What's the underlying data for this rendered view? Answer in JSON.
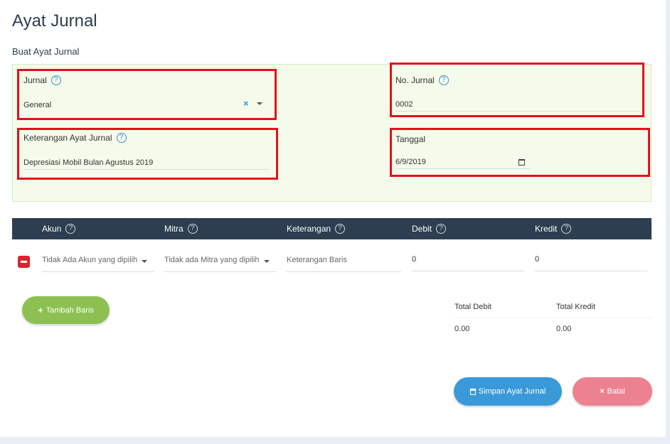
{
  "page": {
    "title": "Ayat Jurnal",
    "section_title": "Buat Ayat Jurnal"
  },
  "form": {
    "jurnal_label": "Jurnal",
    "jurnal_value": "General",
    "no_jurnal_label": "No. Jurnal",
    "no_jurnal_value": "0002",
    "keterangan_label": "Keterangan Ayat Jurnal",
    "keterangan_value": "Depresiasi Mobil Bulan Agustus 2019",
    "tanggal_label": "Tanggal",
    "tanggal_value": "6/9/2019",
    "help_glyph": "?",
    "clear_glyph": "×"
  },
  "table": {
    "headers": {
      "akun": "Akun",
      "mitra": "Mitra",
      "keterangan": "Keterangan",
      "debit": "Debit",
      "kredit": "Kredit"
    },
    "row": {
      "akun_placeholder": "Tidak Ada Akun yang dipilih",
      "mitra_placeholder": "Tidak ada Mitra yang dipilih",
      "keterangan_placeholder": "Keterangan Baris",
      "debit": "0",
      "kredit": "0"
    }
  },
  "buttons": {
    "add_row": "Tambah Baris",
    "save": "Simpan Ayat Jurnal",
    "cancel": "Batal",
    "plus_glyph": "+",
    "x_glyph": "×"
  },
  "totals": {
    "debit_label": "Total Debit",
    "kredit_label": "Total Kredit",
    "debit_value": "0.00",
    "kredit_value": "0.00"
  },
  "colors": {
    "header_bg": "#2d3e50",
    "panel_bg": "#f4fbea",
    "highlight": "#e3101b",
    "add_button": "#8cc152",
    "save_button": "#3a9ad9",
    "cancel_button": "#ec8290"
  },
  "icons": [
    "help-icon",
    "clear-icon",
    "chevron-down-icon",
    "calendar-icon",
    "minus-icon",
    "plus-icon",
    "save-icon",
    "close-icon"
  ]
}
